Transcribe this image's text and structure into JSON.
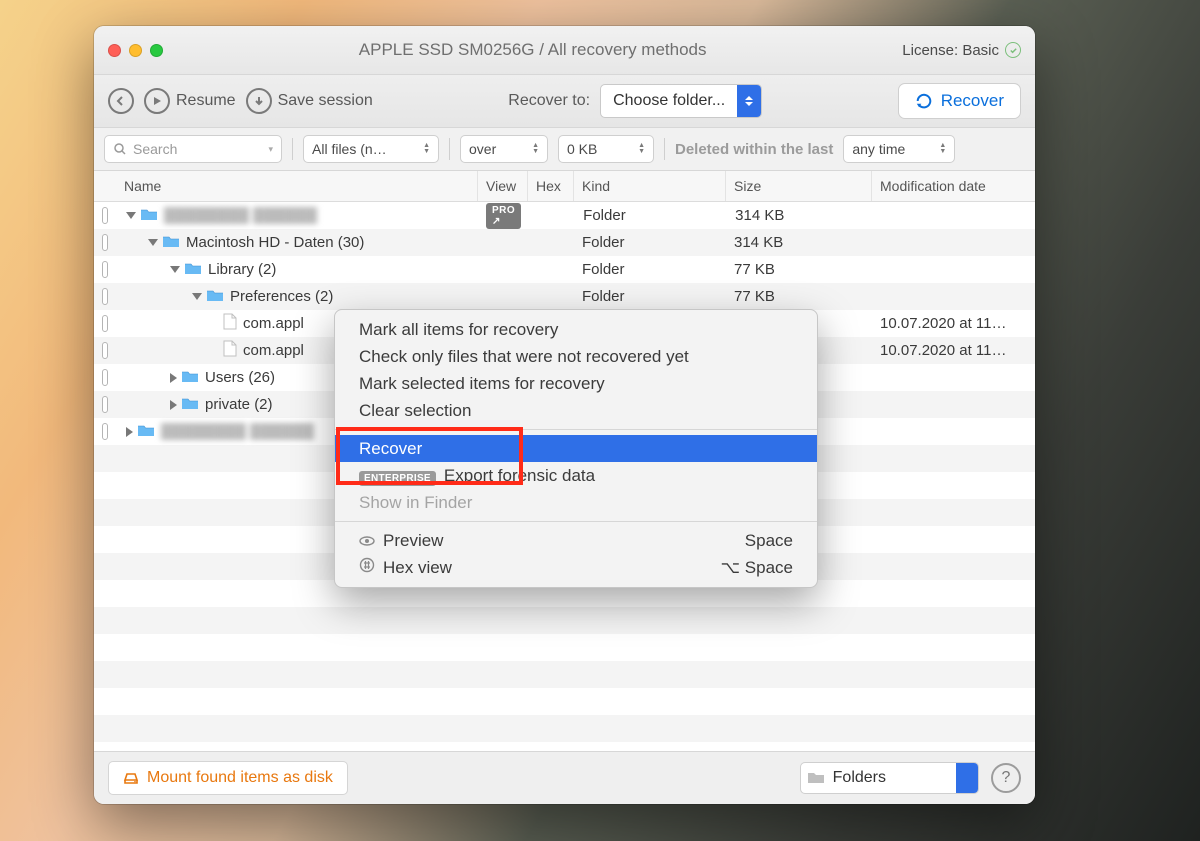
{
  "title": "APPLE SSD SM0256G / All recovery methods",
  "license": {
    "label": "License: Basic"
  },
  "toolbar": {
    "resume": "Resume",
    "save": "Save session",
    "recover_to": "Recover to:",
    "choose": "Choose folder...",
    "recover": "Recover"
  },
  "filters": {
    "search_ph": "Search",
    "all": "All files (n…",
    "over": "over",
    "size": "0 KB",
    "deleted": "Deleted within the last",
    "any": "any time"
  },
  "columns": {
    "name": "Name",
    "view": "View",
    "hex": "Hex",
    "kind": "Kind",
    "size": "Size",
    "mod": "Modification date"
  },
  "tree": [
    {
      "indent": 0,
      "tri": "dn",
      "blur": true,
      "kind": "Folder",
      "size": "314 KB",
      "pro": true,
      "mod": ""
    },
    {
      "indent": 1,
      "tri": "dn",
      "name": "Macintosh HD - Daten (30)",
      "kind": "Folder",
      "size": "314 KB",
      "mod": ""
    },
    {
      "indent": 2,
      "tri": "dn",
      "name": "Library (2)",
      "kind": "Folder",
      "size": "77 KB",
      "mod": ""
    },
    {
      "indent": 3,
      "tri": "dn",
      "name": "Preferences (2)",
      "kind": "Folder",
      "size": "77 KB",
      "mod": ""
    },
    {
      "indent": 4,
      "file": true,
      "name": "com.appl",
      "kind": "",
      "size": "",
      "mod": "10.07.2020 at 11…"
    },
    {
      "indent": 4,
      "file": true,
      "name": "com.appl",
      "kind": "",
      "size": "",
      "mod": "10.07.2020 at 11…"
    },
    {
      "indent": 2,
      "tri": "rt",
      "name": "Users (26)",
      "kind": "",
      "size": "",
      "mod": ""
    },
    {
      "indent": 2,
      "tri": "rt",
      "name": "private (2)",
      "kind": "",
      "size": "",
      "mod": ""
    },
    {
      "indent": 0,
      "tri": "rt",
      "blur": true,
      "kind": "",
      "size": "",
      "mod": ""
    }
  ],
  "ctx": {
    "mark_all": "Mark all items for recovery",
    "check_not": "Check only files that were not recovered yet",
    "mark_sel": "Mark selected items for recovery",
    "clear": "Clear selection",
    "recover": "Recover",
    "export": "Export forensic data",
    "enterprise": "ENTERPRISE",
    "show": "Show in Finder",
    "preview": "Preview",
    "preview_key": "Space",
    "hex": "Hex view",
    "hex_key": "⌥ Space"
  },
  "footer": {
    "mount": "Mount found items as disk",
    "folders": "Folders"
  }
}
